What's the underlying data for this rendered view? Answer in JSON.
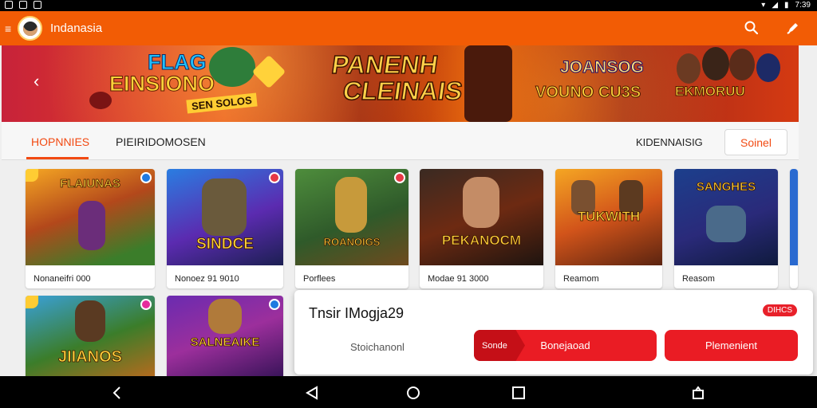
{
  "status_bar": {
    "time": "7:39"
  },
  "app_bar": {
    "title": "Indanasia"
  },
  "banner": {
    "text_flag": "FLAG",
    "text_einsiono": "EINSIONO",
    "text_ribbon": "SEN SOLOS",
    "text_panenh": "PANENH",
    "text_cleinais": "CLEINAIS",
    "text_joansog": "JOANSOG",
    "text_vouno": "VOUNO CU3S",
    "text_ekmoruu": "EKMORUU"
  },
  "tabs": {
    "primary": "HOPNNIES",
    "secondary": "PIEIRIDOMOSEN",
    "right_label": "KIDENNAISIG",
    "select_button": "Soinel"
  },
  "games_row1": [
    {
      "thumb_title": "FLAIUNAS",
      "caption": "Nonaneifri 000"
    },
    {
      "thumb_title": "SINDCE",
      "caption": "Nonoez    91 9010"
    },
    {
      "thumb_title": "ROANOIGS",
      "caption": "Porflees"
    },
    {
      "thumb_title": "PEKANOCM",
      "caption": "Modae   91 3000"
    },
    {
      "thumb_title": "TUKWITH",
      "caption": "Reamom"
    },
    {
      "thumb_title": "SANGHES",
      "caption": "Reasom"
    }
  ],
  "games_row2": [
    {
      "thumb_title": "JIIANOS"
    },
    {
      "thumb_title": "SALNEAIKE"
    }
  ],
  "popup": {
    "title": "Tnsir IMogja29",
    "badge": "DIHCS",
    "subtitle": "Stoichanonl",
    "button1_tag": "Sonde",
    "button1_label": "Bonejaoad",
    "button2_label": "Plemenient"
  },
  "colors": {
    "accent": "#f25c05",
    "cta": "#ea1c24"
  }
}
